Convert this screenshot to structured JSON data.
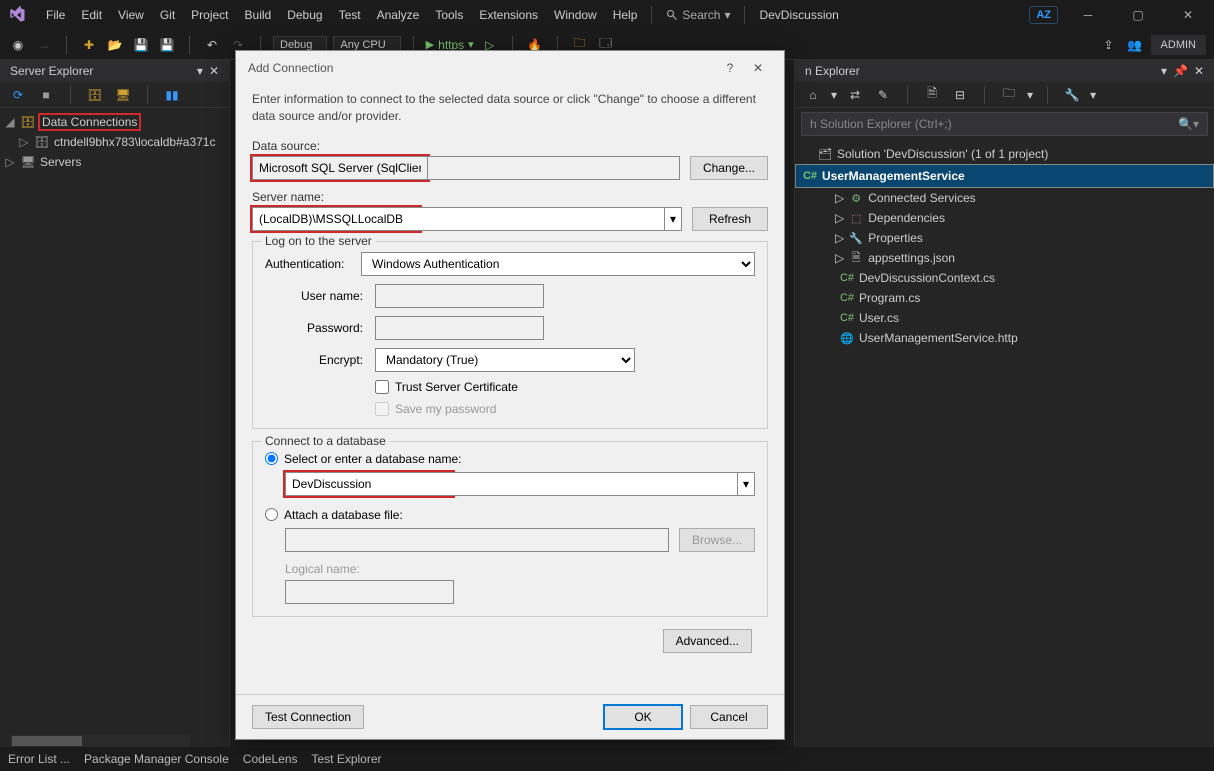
{
  "menu": {
    "file": "File",
    "edit": "Edit",
    "view": "View",
    "git": "Git",
    "project": "Project",
    "build": "Build",
    "debug": "Debug",
    "test": "Test",
    "analyze": "Analyze",
    "tools": "Tools",
    "extensions": "Extensions",
    "window": "Window",
    "help": "Help"
  },
  "search_label": "Search",
  "solution_name": "DevDiscussion",
  "az": "AZ",
  "admin": "ADMIN",
  "toolbar": {
    "config": "Debug",
    "platform": "Any CPU",
    "run": "https"
  },
  "server_explorer": {
    "title": "Server Explorer",
    "data_connections": "Data Connections",
    "conn": "ctndell9bhx783\\localdb#a371c",
    "servers": "Servers"
  },
  "solution_explorer": {
    "title": "Solution Explorer",
    "search_ph": "Search Solution Explorer (Ctrl+;)",
    "root": "Solution 'DevDiscussion' (1 of 1 project)",
    "project": "UserManagementService",
    "items": [
      "Connected Services",
      "Dependencies",
      "Properties",
      "appsettings.json",
      "DevDiscussionContext.cs",
      "Program.cs",
      "User.cs",
      "UserManagementService.http"
    ]
  },
  "dialog": {
    "title": "Add Connection",
    "intro": "Enter information to connect to the selected data source or click \"Change\" to choose a different data source and/or provider.",
    "data_source_lbl": "Data source:",
    "data_source_val": "Microsoft SQL Server (SqlClient)",
    "change": "Change...",
    "server_name_lbl": "Server name:",
    "server_name_val": "(LocalDB)\\MSSQLLocalDB",
    "refresh": "Refresh",
    "logon_grp": "Log on to the server",
    "auth_lbl": "Authentication:",
    "auth_val": "Windows Authentication",
    "user_lbl": "User name:",
    "pass_lbl": "Password:",
    "encrypt_lbl": "Encrypt:",
    "encrypt_val": "Mandatory (True)",
    "trust_cert": "Trust Server Certificate",
    "save_pw": "Save my password",
    "db_grp": "Connect to a database",
    "radio_select": "Select or enter a database name:",
    "db_name": "DevDiscussion",
    "radio_attach": "Attach a database file:",
    "browse": "Browse...",
    "logical_name": "Logical name:",
    "advanced": "Advanced...",
    "test": "Test Connection",
    "ok": "OK",
    "cancel": "Cancel"
  },
  "statusbar": {
    "err": "Error List ...",
    "pmc": "Package Manager Console",
    "codelens": "CodeLens",
    "testexp": "Test Explorer"
  }
}
